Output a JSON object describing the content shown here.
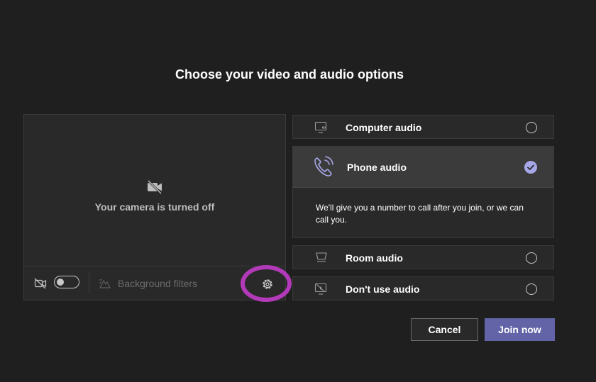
{
  "dialog": {
    "title": "Choose your video and audio options"
  },
  "video": {
    "camera_off_text": "Your camera is turned off",
    "background_filters_label": "Background filters",
    "camera_enabled": false
  },
  "audio_options": [
    {
      "id": "computer",
      "label": "Computer audio",
      "icon": "computer-audio-icon",
      "selected": false
    },
    {
      "id": "phone",
      "label": "Phone audio",
      "icon": "phone-icon",
      "selected": true,
      "description": "We'll give you a number to call after you join, or we can call you."
    },
    {
      "id": "room",
      "label": "Room audio",
      "icon": "room-audio-icon",
      "selected": false
    },
    {
      "id": "none",
      "label": "Don't use audio",
      "icon": "no-audio-icon",
      "selected": false
    }
  ],
  "actions": {
    "cancel_label": "Cancel",
    "join_label": "Join now"
  },
  "colors": {
    "accent": "#6264a7",
    "selected_check": "#a6a7e8",
    "highlight_ring": "#b23ab8"
  }
}
